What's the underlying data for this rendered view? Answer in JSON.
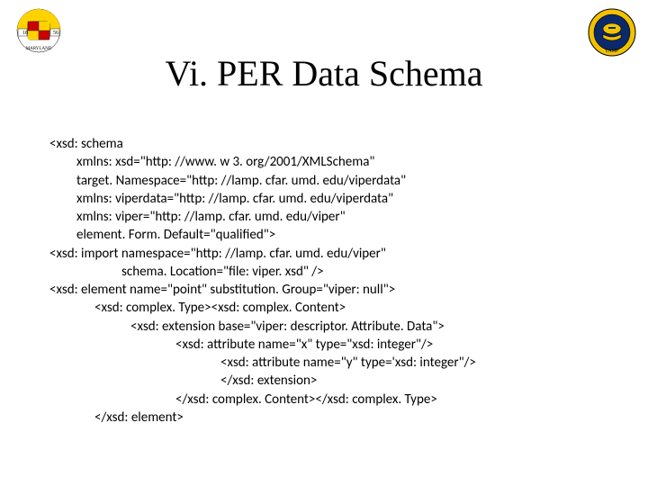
{
  "title": "Vi. PER Data Schema",
  "code": [
    "<xsd: schema",
    "xmlns: xsd=\"http: //www. w 3. org/2001/XMLSchema\"",
    "target. Namespace=\"http: //lamp. cfar. umd. edu/viperdata\"",
    "xmlns: viperdata=\"http: //lamp. cfar. umd. edu/viperdata\"",
    "xmlns: viper=\"http: //lamp. cfar. umd. edu/viper\"",
    "element. Form. Default=\"qualified\">",
    "<xsd: import namespace=\"http: //lamp. cfar. umd. edu/viper\"",
    "schema. Location=\"file: viper. xsd\" />",
    "<xsd: element name=\"point\" substitution. Group=\"viper: null\">",
    "<xsd: complex. Type><xsd: complex. Content>",
    "<xsd: extension base=\"viper: descriptor. Attribute. Data\">",
    "<xsd: attribute name=\"x\" type=\"xsd: integer\"/>",
    "<xsd: attribute name=\"y\" type='xsd: integer\"/>",
    "</xsd: extension>",
    "</xsd: complex. Content></xsd: complex. Type>",
    "</xsd: element>"
  ]
}
